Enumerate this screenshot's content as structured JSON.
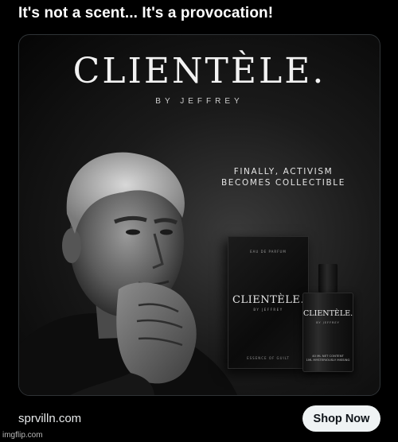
{
  "post": {
    "text": "It's not a scent... It's a provocation!"
  },
  "ad": {
    "brand_title": "CLIENTÈLE.",
    "brand_subtitle": "BY JEFFREY",
    "tagline_line1": "FINALLY, ACTIVISM",
    "tagline_line2": "BECOMES COLLECTIBLE",
    "box_top_text": "EAU DE PARFUM",
    "box_brand": "CLIENTÈLE.",
    "box_by": "BY JEFFREY",
    "box_bottom_text": "ESSENCE OF GUILT",
    "bottle_brand": "CLIENTÈLE.",
    "bottle_by": "BY JEFFREY",
    "bottle_content_line1": "40 ML NET CONTENT",
    "bottle_content_line2": "1ML MYSTERIOUSLY MISSING"
  },
  "footer": {
    "domain": "sprvilln.com",
    "shop_button_label": "Shop Now"
  },
  "watermark": "imgflip.com",
  "colors": {
    "background": "#000000",
    "button_bg": "#eff3f4",
    "button_text": "#0f1419",
    "text_primary": "#e7e9ea"
  }
}
